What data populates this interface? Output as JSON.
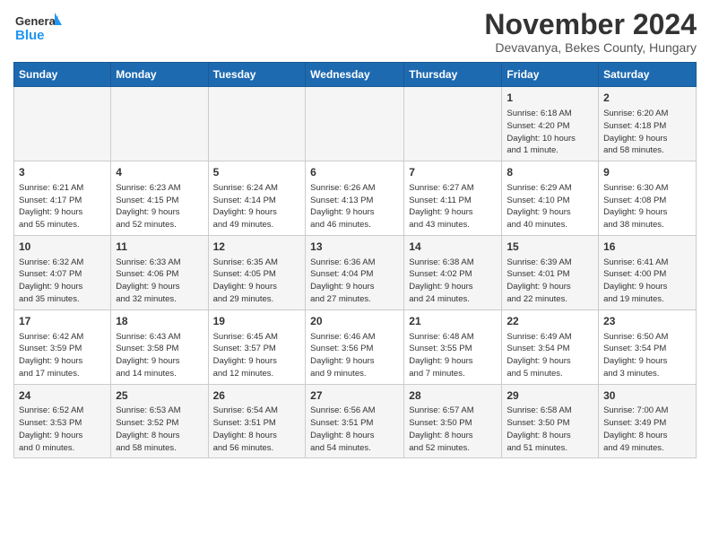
{
  "header": {
    "logo_line1": "General",
    "logo_line2": "Blue",
    "month": "November 2024",
    "location": "Devavanya, Bekes County, Hungary"
  },
  "weekdays": [
    "Sunday",
    "Monday",
    "Tuesday",
    "Wednesday",
    "Thursday",
    "Friday",
    "Saturday"
  ],
  "weeks": [
    [
      {
        "day": "",
        "info": ""
      },
      {
        "day": "",
        "info": ""
      },
      {
        "day": "",
        "info": ""
      },
      {
        "day": "",
        "info": ""
      },
      {
        "day": "",
        "info": ""
      },
      {
        "day": "1",
        "info": "Sunrise: 6:18 AM\nSunset: 4:20 PM\nDaylight: 10 hours\nand 1 minute."
      },
      {
        "day": "2",
        "info": "Sunrise: 6:20 AM\nSunset: 4:18 PM\nDaylight: 9 hours\nand 58 minutes."
      }
    ],
    [
      {
        "day": "3",
        "info": "Sunrise: 6:21 AM\nSunset: 4:17 PM\nDaylight: 9 hours\nand 55 minutes."
      },
      {
        "day": "4",
        "info": "Sunrise: 6:23 AM\nSunset: 4:15 PM\nDaylight: 9 hours\nand 52 minutes."
      },
      {
        "day": "5",
        "info": "Sunrise: 6:24 AM\nSunset: 4:14 PM\nDaylight: 9 hours\nand 49 minutes."
      },
      {
        "day": "6",
        "info": "Sunrise: 6:26 AM\nSunset: 4:13 PM\nDaylight: 9 hours\nand 46 minutes."
      },
      {
        "day": "7",
        "info": "Sunrise: 6:27 AM\nSunset: 4:11 PM\nDaylight: 9 hours\nand 43 minutes."
      },
      {
        "day": "8",
        "info": "Sunrise: 6:29 AM\nSunset: 4:10 PM\nDaylight: 9 hours\nand 40 minutes."
      },
      {
        "day": "9",
        "info": "Sunrise: 6:30 AM\nSunset: 4:08 PM\nDaylight: 9 hours\nand 38 minutes."
      }
    ],
    [
      {
        "day": "10",
        "info": "Sunrise: 6:32 AM\nSunset: 4:07 PM\nDaylight: 9 hours\nand 35 minutes."
      },
      {
        "day": "11",
        "info": "Sunrise: 6:33 AM\nSunset: 4:06 PM\nDaylight: 9 hours\nand 32 minutes."
      },
      {
        "day": "12",
        "info": "Sunrise: 6:35 AM\nSunset: 4:05 PM\nDaylight: 9 hours\nand 29 minutes."
      },
      {
        "day": "13",
        "info": "Sunrise: 6:36 AM\nSunset: 4:04 PM\nDaylight: 9 hours\nand 27 minutes."
      },
      {
        "day": "14",
        "info": "Sunrise: 6:38 AM\nSunset: 4:02 PM\nDaylight: 9 hours\nand 24 minutes."
      },
      {
        "day": "15",
        "info": "Sunrise: 6:39 AM\nSunset: 4:01 PM\nDaylight: 9 hours\nand 22 minutes."
      },
      {
        "day": "16",
        "info": "Sunrise: 6:41 AM\nSunset: 4:00 PM\nDaylight: 9 hours\nand 19 minutes."
      }
    ],
    [
      {
        "day": "17",
        "info": "Sunrise: 6:42 AM\nSunset: 3:59 PM\nDaylight: 9 hours\nand 17 minutes."
      },
      {
        "day": "18",
        "info": "Sunrise: 6:43 AM\nSunset: 3:58 PM\nDaylight: 9 hours\nand 14 minutes."
      },
      {
        "day": "19",
        "info": "Sunrise: 6:45 AM\nSunset: 3:57 PM\nDaylight: 9 hours\nand 12 minutes."
      },
      {
        "day": "20",
        "info": "Sunrise: 6:46 AM\nSunset: 3:56 PM\nDaylight: 9 hours\nand 9 minutes."
      },
      {
        "day": "21",
        "info": "Sunrise: 6:48 AM\nSunset: 3:55 PM\nDaylight: 9 hours\nand 7 minutes."
      },
      {
        "day": "22",
        "info": "Sunrise: 6:49 AM\nSunset: 3:54 PM\nDaylight: 9 hours\nand 5 minutes."
      },
      {
        "day": "23",
        "info": "Sunrise: 6:50 AM\nSunset: 3:54 PM\nDaylight: 9 hours\nand 3 minutes."
      }
    ],
    [
      {
        "day": "24",
        "info": "Sunrise: 6:52 AM\nSunset: 3:53 PM\nDaylight: 9 hours\nand 0 minutes."
      },
      {
        "day": "25",
        "info": "Sunrise: 6:53 AM\nSunset: 3:52 PM\nDaylight: 8 hours\nand 58 minutes."
      },
      {
        "day": "26",
        "info": "Sunrise: 6:54 AM\nSunset: 3:51 PM\nDaylight: 8 hours\nand 56 minutes."
      },
      {
        "day": "27",
        "info": "Sunrise: 6:56 AM\nSunset: 3:51 PM\nDaylight: 8 hours\nand 54 minutes."
      },
      {
        "day": "28",
        "info": "Sunrise: 6:57 AM\nSunset: 3:50 PM\nDaylight: 8 hours\nand 52 minutes."
      },
      {
        "day": "29",
        "info": "Sunrise: 6:58 AM\nSunset: 3:50 PM\nDaylight: 8 hours\nand 51 minutes."
      },
      {
        "day": "30",
        "info": "Sunrise: 7:00 AM\nSunset: 3:49 PM\nDaylight: 8 hours\nand 49 minutes."
      }
    ]
  ]
}
